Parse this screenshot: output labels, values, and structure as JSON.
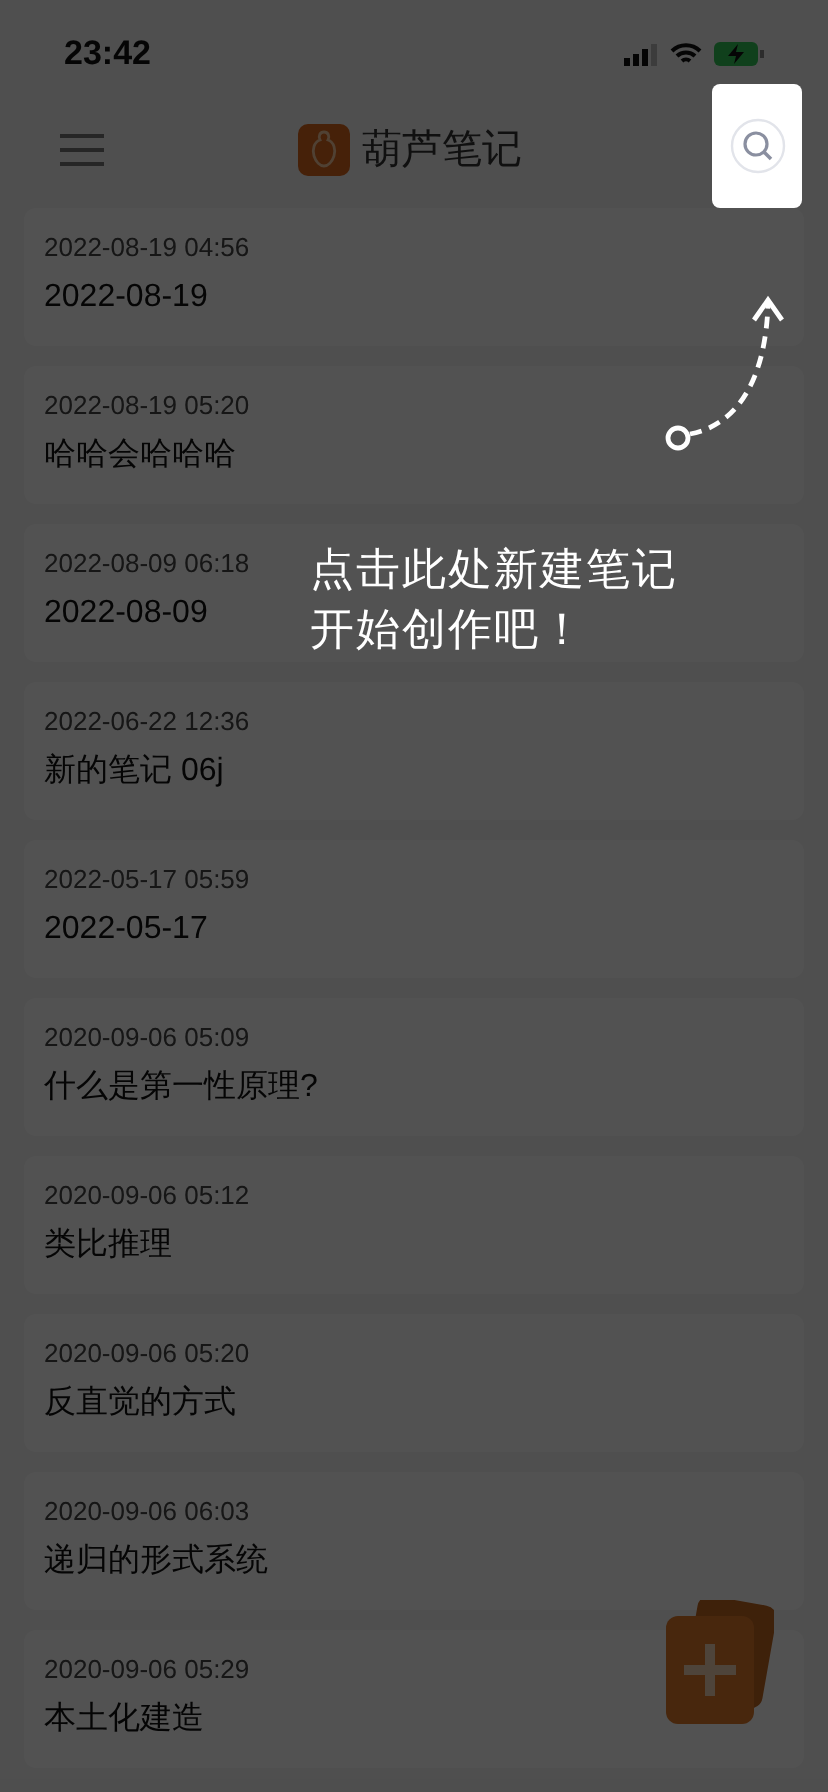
{
  "status_bar": {
    "time": "23:42"
  },
  "header": {
    "title": "葫芦笔记"
  },
  "notes": [
    {
      "date": "2022-08-19 04:56",
      "title": "2022-08-19"
    },
    {
      "date": "2022-08-19 05:20",
      "title": "哈哈会哈哈哈"
    },
    {
      "date": "2022-08-09 06:18",
      "title": "2022-08-09"
    },
    {
      "date": "2022-06-22 12:36",
      "title": "新的笔记 06j"
    },
    {
      "date": "2022-05-17 05:59",
      "title": "2022-05-17"
    },
    {
      "date": "2020-09-06 05:09",
      "title": "什么是第一性原理?"
    },
    {
      "date": "2020-09-06 05:12",
      "title": "类比推理"
    },
    {
      "date": "2020-09-06 05:20",
      "title": "反直觉的方式"
    },
    {
      "date": "2020-09-06 06:03",
      "title": "递归的形式系统"
    },
    {
      "date": "2020-09-06 05:29",
      "title": "本土化建造"
    }
  ],
  "guide": {
    "lines": [
      "点击此处新建笔记",
      "开始创作吧！"
    ]
  }
}
